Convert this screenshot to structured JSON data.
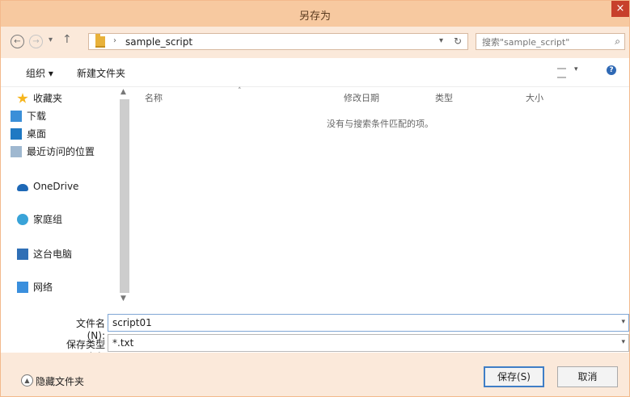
{
  "window": {
    "title": "另存为",
    "close_icon": "close-icon",
    "close_label": "×"
  },
  "navigation": {
    "back_label": "←",
    "forward_label": "→",
    "recent_label": "▾",
    "up_label": "↑",
    "path_separator": "›",
    "path": "sample_script",
    "refresh_label": "↻",
    "search_placeholder": "搜索\"sample_script\"",
    "search_icon": "search-icon"
  },
  "toolbar": {
    "organize_label": "组织 ▾",
    "new_folder_label": "新建文件夹",
    "view_arrow": "▾",
    "help_label": "?"
  },
  "sidebar": {
    "items": [
      {
        "label": "收藏夹",
        "icon": "star-icon"
      },
      {
        "label": "下载",
        "icon": "download-folder-icon"
      },
      {
        "label": "桌面",
        "icon": "desktop-icon"
      },
      {
        "label": "最近访问的位置",
        "icon": "recent-places-icon"
      },
      {
        "label": "OneDrive",
        "icon": "onedrive-icon"
      },
      {
        "label": "家庭组",
        "icon": "homegroup-icon"
      },
      {
        "label": "这台电脑",
        "icon": "this-pc-icon"
      },
      {
        "label": "网络",
        "icon": "network-icon"
      }
    ],
    "scroll_up": "▲",
    "scroll_down": "▼"
  },
  "file_list": {
    "columns": [
      "名称",
      "修改日期",
      "类型",
      "大小"
    ],
    "sort_mark": "˄",
    "empty_message": "没有与搜索条件匹配的项。"
  },
  "form": {
    "filename_label": "文件名(N):",
    "filename_value": "script01",
    "filetype_label": "保存类型(T):",
    "filetype_value": "*.txt",
    "dropdown_arrow": "▾"
  },
  "footer": {
    "hide_folders_label": "隐藏文件夹",
    "hide_folders_icon": "chevron-up-icon",
    "hide_folders_symbol": "▲",
    "save_label": "保存(S)",
    "cancel_label": "取消"
  },
  "colors": {
    "title_bar": "#f7c9a0",
    "navigation_bar": "#fbe9da",
    "close_button": "#c7402b",
    "selection_border": "#3f7ec6"
  }
}
